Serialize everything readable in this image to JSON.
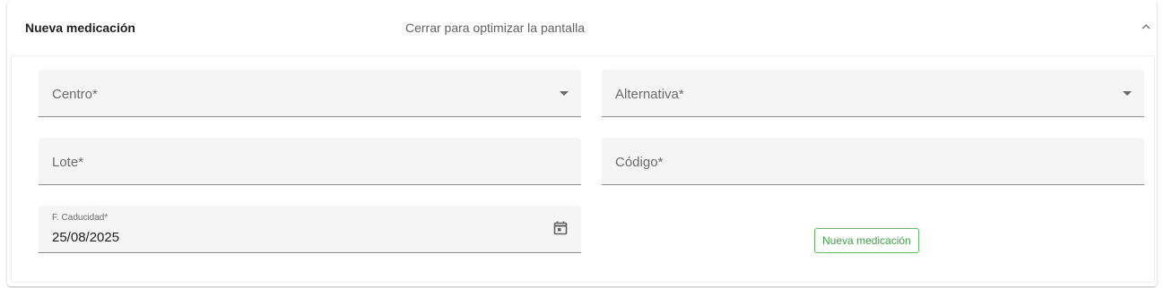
{
  "header": {
    "title": "Nueva medicación",
    "description": "Cerrar para optimizar la pantalla",
    "collapse_icon": "chevron-up-icon"
  },
  "form": {
    "centro": {
      "label": "Centro*",
      "icon": "dropdown-arrow-icon"
    },
    "alternativa": {
      "label": "Alternativa*",
      "icon": "dropdown-arrow-icon"
    },
    "lote": {
      "label": "Lote*"
    },
    "codigo": {
      "label": "Código*"
    },
    "caducidad": {
      "label": "F. Caducidad*",
      "value": "25/08/2025",
      "icon": "calendar-icon"
    }
  },
  "actions": {
    "submit_label": "Nueva medicación",
    "submit_color": "#43a047"
  }
}
